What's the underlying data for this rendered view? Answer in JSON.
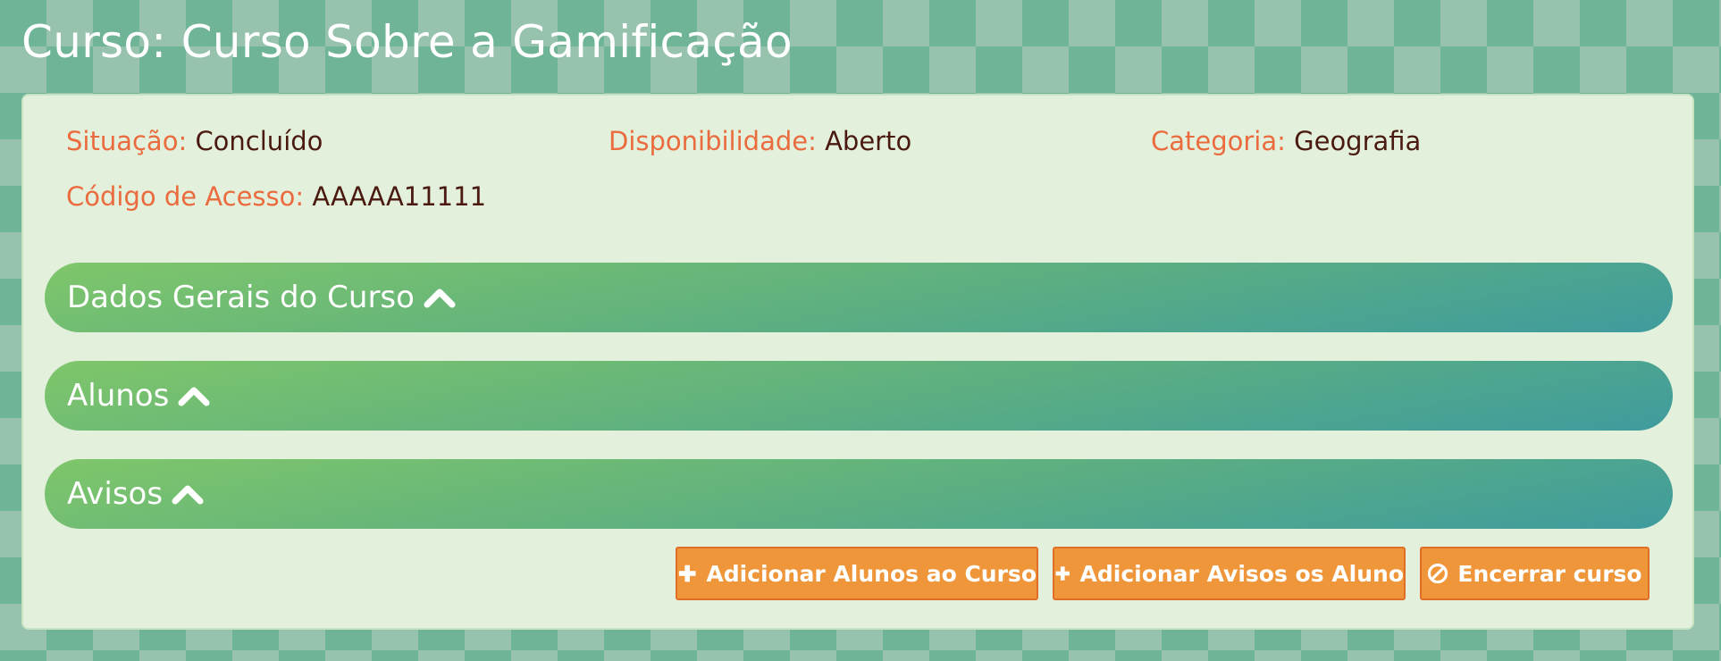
{
  "page": {
    "title": "Curso: Curso Sobre a Gamificação"
  },
  "info": {
    "situacao_label": "Situação:",
    "situacao_value": "Concluído",
    "disponibilidade_label": "Disponibilidade:",
    "disponibilidade_value": "Aberto",
    "categoria_label": "Categoria:",
    "categoria_value": "Geografia",
    "codigo_label": "Código de Acesso:",
    "codigo_value": "AAAAA11111"
  },
  "sections": [
    {
      "label": "Dados Gerais do Curso",
      "icon": "chevron-up-icon"
    },
    {
      "label": "Alunos",
      "icon": "chevron-up-icon"
    },
    {
      "label": "Avisos",
      "icon": "chevron-up-icon"
    }
  ],
  "actions": {
    "add_students_label": "Adicionar Alunos ao Curso",
    "add_notices_label": "Adicionar Avisos os Aluno",
    "close_course_label": "Encerrar curso"
  },
  "colors": {
    "label_orange": "#ea6b3e",
    "value_brown": "#4a1a10",
    "button_orange": "#f0963a",
    "panel_bg": "#e3f0dc",
    "accordion_green_start": "#7fc66a",
    "accordion_teal_end": "#3f9b9e"
  }
}
